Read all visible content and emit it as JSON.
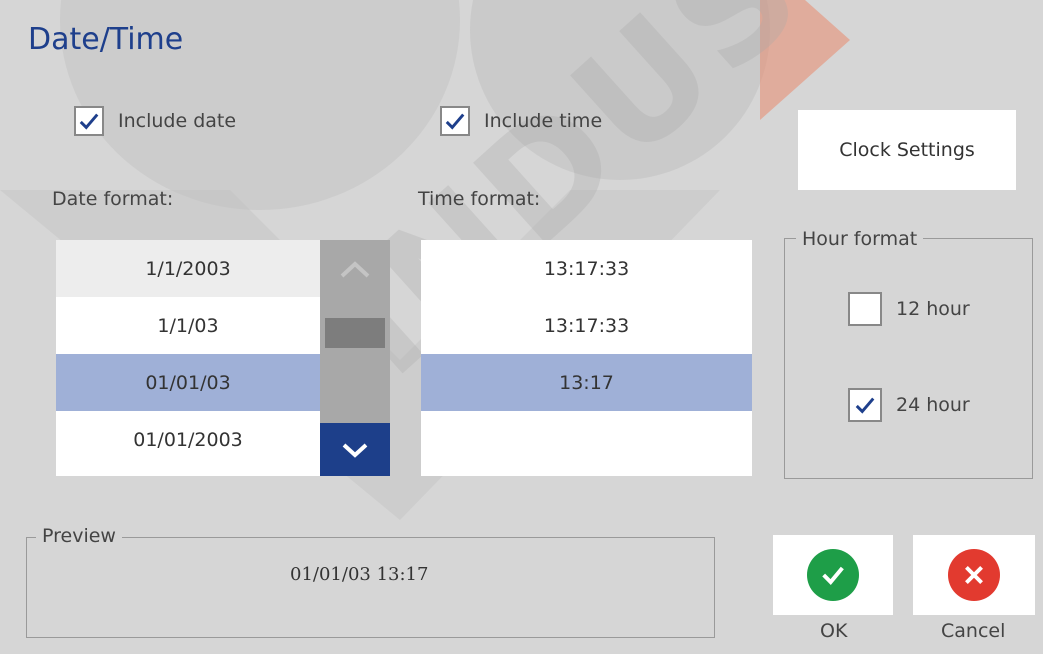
{
  "dialog": {
    "title": "Date/Time"
  },
  "include_date": {
    "label": "Include date",
    "checked": true
  },
  "include_time": {
    "label": "Include time",
    "checked": true
  },
  "clock_settings": {
    "label": "Clock Settings"
  },
  "date_format": {
    "label": "Date format:",
    "items": [
      "1/1/2003",
      "1/1/03",
      "01/01/03",
      "01/01/2003"
    ],
    "selected_index": 2
  },
  "time_format": {
    "label": "Time format:",
    "items": [
      "13:17:33",
      "13:17:33",
      "13:17",
      ""
    ],
    "selected_index": 2
  },
  "hour_format": {
    "title": "Hour format",
    "options": [
      {
        "label": "12 hour",
        "checked": false
      },
      {
        "label": "24 hour",
        "checked": true
      }
    ]
  },
  "preview": {
    "title": "Preview",
    "value": "01/01/03 13:17"
  },
  "ok": {
    "label": "OK",
    "icon": "checkmark-icon",
    "color": "#1e9e48"
  },
  "cancel": {
    "label": "Cancel",
    "icon": "x-icon",
    "color": "#e23a2f"
  },
  "watermark": {
    "text": "INDUSTRIAL"
  },
  "colors": {
    "accent": "#1e3f8c",
    "selection": "#9fb0d7",
    "background": "#d6d6d6"
  }
}
